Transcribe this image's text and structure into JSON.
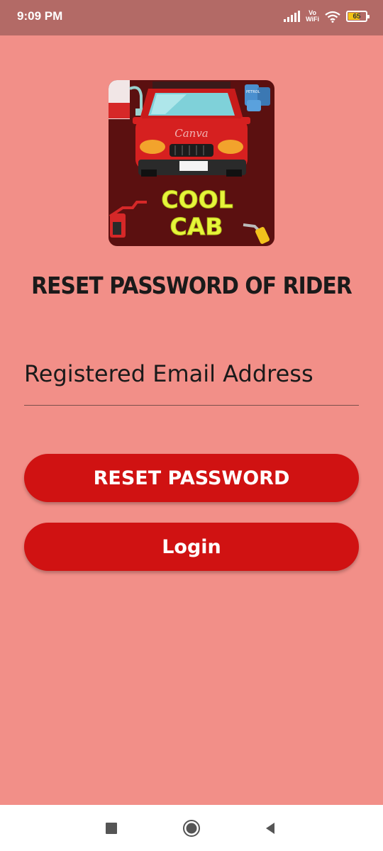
{
  "status_bar": {
    "time": "9:09 PM",
    "network": "Vo\nWiFi",
    "battery": "65",
    "battery_level": 0.65
  },
  "logo": {
    "title_line1": "COOL",
    "title_line2": "CAB",
    "watermark": "Canva",
    "barrel_label": "PETROL"
  },
  "page": {
    "title": "RESET PASSWORD OF RIDER"
  },
  "form": {
    "email_placeholder": "Registered Email Address",
    "email_value": ""
  },
  "buttons": {
    "reset_label": "RESET PASSWORD",
    "login_label": "Login"
  },
  "nav": {
    "icons": [
      "recent-apps-icon",
      "home-icon",
      "back-icon"
    ]
  },
  "colors": {
    "background": "#f28f88",
    "status_bar": "#b36a66",
    "button": "#d01212",
    "logo_background": "#5b1010",
    "logo_text": "#e7f53b"
  }
}
